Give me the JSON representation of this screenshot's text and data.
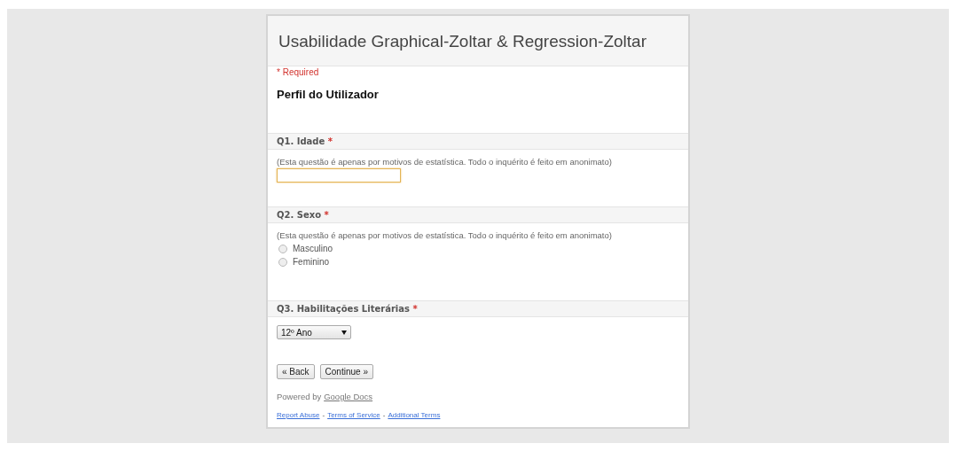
{
  "form": {
    "title": "Usabilidade Graphical-Zoltar & Regression-Zoltar",
    "required_note": "* Required",
    "section_title": "Perfil do Utilizador",
    "questions": [
      {
        "kind": "text",
        "label": "Q1. Idade",
        "required_mark": "*",
        "help": "(Esta questão é apenas por motivos de estatística. Todo o inquérito é feito em anonimato)",
        "focused": true
      },
      {
        "kind": "radio",
        "label": "Q2. Sexo",
        "required_mark": "*",
        "help": "(Esta questão é apenas por motivos de estatística. Todo o inquérito é feito em anonimato)",
        "options": [
          {
            "label": "Masculino",
            "selected": false
          },
          {
            "label": "Feminino",
            "selected": false
          }
        ]
      },
      {
        "kind": "select",
        "label": "Q3. Habilitações Literárias",
        "required_mark": "*",
        "value": "12º Ano"
      }
    ],
    "buttons": [
      "« Back",
      "Continue »"
    ],
    "powered_by": {
      "text": "Powered by",
      "link": "Google Docs"
    },
    "footer_links": [
      "Report Abuse",
      "Terms of Service",
      "Additional Terms"
    ],
    "footer_separator": "-"
  }
}
